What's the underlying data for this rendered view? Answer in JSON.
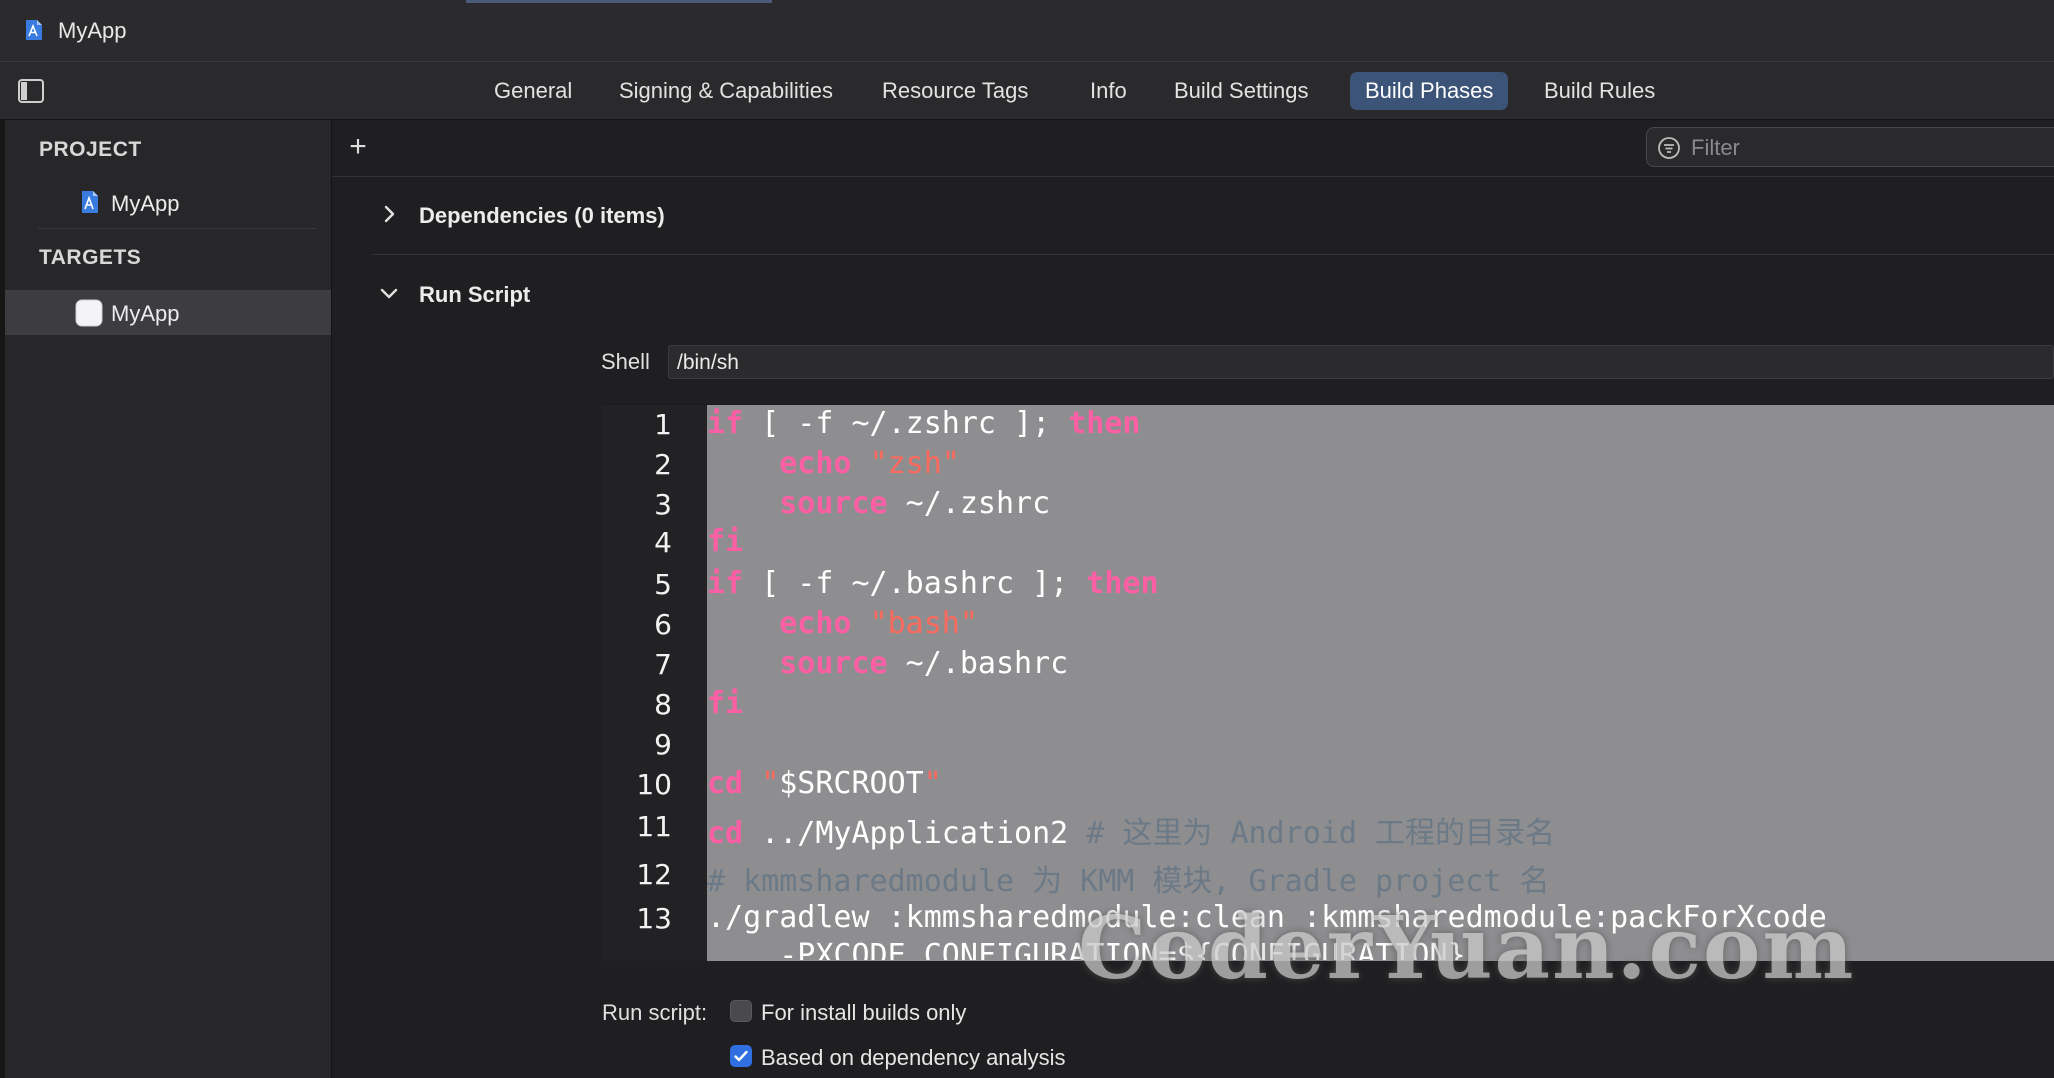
{
  "window": {
    "title": "MyApp"
  },
  "tabs": [
    {
      "label": "General",
      "active": false
    },
    {
      "label": "Signing & Capabilities",
      "active": false
    },
    {
      "label": "Resource Tags",
      "active": false
    },
    {
      "label": "Info",
      "active": false
    },
    {
      "label": "Build Settings",
      "active": false
    },
    {
      "label": "Build Phases",
      "active": true
    },
    {
      "label": "Build Rules",
      "active": false
    }
  ],
  "sidebar": {
    "project_heading": "PROJECT",
    "project_item": "MyApp",
    "targets_heading": "TARGETS",
    "target_item": "MyApp"
  },
  "toolbar": {
    "add_label": "+",
    "filter_placeholder": "Filter"
  },
  "phases": {
    "dependencies": {
      "title": "Dependencies (0 items)",
      "expanded": false
    },
    "run_script": {
      "title": "Run Script",
      "expanded": true,
      "shell_label": "Shell",
      "shell_value": "/bin/sh",
      "code_lines": [
        {
          "n": "1",
          "tokens": [
            [
              "kw",
              "if"
            ],
            [
              "plain",
              " [ -f ~/.zshrc ]; "
            ],
            [
              "kw",
              "then"
            ]
          ]
        },
        {
          "n": "2",
          "tokens": [
            [
              "plain",
              "    "
            ],
            [
              "kw",
              "echo"
            ],
            [
              "plain",
              " "
            ],
            [
              "str",
              "\"zsh\""
            ]
          ]
        },
        {
          "n": "3",
          "tokens": [
            [
              "plain",
              "    "
            ],
            [
              "kw",
              "source"
            ],
            [
              "plain",
              " ~/.zshrc"
            ]
          ]
        },
        {
          "n": "4",
          "tokens": [
            [
              "kw",
              "fi"
            ]
          ]
        },
        {
          "n": "5",
          "tokens": [
            [
              "kw",
              "if"
            ],
            [
              "plain",
              " [ -f ~/.bashrc ]; "
            ],
            [
              "kw",
              "then"
            ]
          ]
        },
        {
          "n": "6",
          "tokens": [
            [
              "plain",
              "    "
            ],
            [
              "kw",
              "echo"
            ],
            [
              "plain",
              " "
            ],
            [
              "str",
              "\"bash\""
            ]
          ]
        },
        {
          "n": "7",
          "tokens": [
            [
              "plain",
              "    "
            ],
            [
              "kw",
              "source"
            ],
            [
              "plain",
              " ~/.bashrc"
            ]
          ]
        },
        {
          "n": "8",
          "tokens": [
            [
              "kw",
              "fi"
            ]
          ]
        },
        {
          "n": "9",
          "tokens": []
        },
        {
          "n": "10",
          "tokens": [
            [
              "kw",
              "cd"
            ],
            [
              "plain",
              " "
            ],
            [
              "str",
              "\""
            ],
            [
              "plain",
              "$SRCROOT"
            ],
            [
              "str",
              "\""
            ]
          ]
        },
        {
          "n": "11",
          "tokens": [
            [
              "kw",
              "cd"
            ],
            [
              "plain",
              " ../MyApplication2 "
            ],
            [
              "cmt",
              "# 这里为 Android 工程的目录名"
            ]
          ]
        },
        {
          "n": "12",
          "tokens": [
            [
              "cmt",
              "# kmmsharedmodule 为 KMM 模块, Gradle project 名"
            ]
          ]
        },
        {
          "n": "13",
          "tokens": [
            [
              "plain",
              "./gradlew :kmmsharedmodule:clean :kmmsharedmodule:packForXcode"
            ]
          ]
        },
        {
          "n": "",
          "tokens": [
            [
              "plain",
              "    -PXCODE_CONFIGURATION=${CONFIGURATION}"
            ]
          ]
        }
      ],
      "options_label": "Run script:",
      "install_builds_only": {
        "label": "For install builds only",
        "checked": false
      },
      "dependency_analysis": {
        "label": "Based on dependency analysis",
        "checked": true
      }
    }
  },
  "watermark": "CoderYuan.com",
  "colors": {
    "keyword": "#fc5fa3",
    "string": "#fc6a5d",
    "comment": "#6c7986",
    "active_tab": "#3b5478",
    "checkbox_on": "#2f6fe0"
  }
}
